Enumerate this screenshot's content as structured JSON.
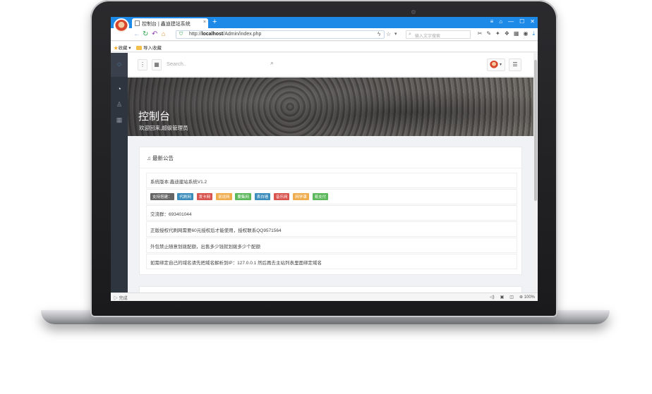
{
  "browser": {
    "tab_title": "控制台 | 鑫迪建站系统",
    "tab_close": "×",
    "new_tab": "+",
    "window_controls": [
      "≡",
      "⌂",
      "—",
      "☐",
      "✕"
    ],
    "url_prefix": "http://",
    "url_host": "localhost",
    "url_path": "/Admin/index.php",
    "search_placeholder": "输入文字搜索",
    "bookmarks": {
      "favorites_label": "收藏",
      "import_label": "导入收藏"
    },
    "status_left": "完成",
    "zoom": "100%"
  },
  "topbar": {
    "search_placeholder": "Search.."
  },
  "hero": {
    "title": "控制台",
    "subtitle": "欢迎回来,超级管理员"
  },
  "notice": {
    "heading": "最新公告",
    "version_text": "系统版本:鑫迪建站系统V1.2",
    "support_label": "支持搭建：",
    "tags": [
      {
        "label": "代刷网",
        "color": "#3c8dbc"
      },
      {
        "label": "发卡网",
        "color": "#d9534f"
      },
      {
        "label": "说说网",
        "color": "#f0ad4e"
      },
      {
        "label": "要集网",
        "color": "#5cb85c"
      },
      {
        "label": "表白墙",
        "color": "#3c8dbc"
      },
      {
        "label": "音乐网",
        "color": "#d9534f"
      },
      {
        "label": "网学课",
        "color": "#f0ad4e"
      },
      {
        "label": "易支付",
        "color": "#5cb85c"
      }
    ],
    "group_text": "交流群：693401044",
    "auth_text": "正版授权代刷网需要60元授权后才能使用，授权联系QQ9571564",
    "ban_text": "外包禁止随意划拨配额，出售多少钱就划拨多少个配额",
    "dns_text": "如需绑定自己的域名请先把域名解析到IP：127.0.0.1 然后再去主站列表里面绑定域名"
  }
}
